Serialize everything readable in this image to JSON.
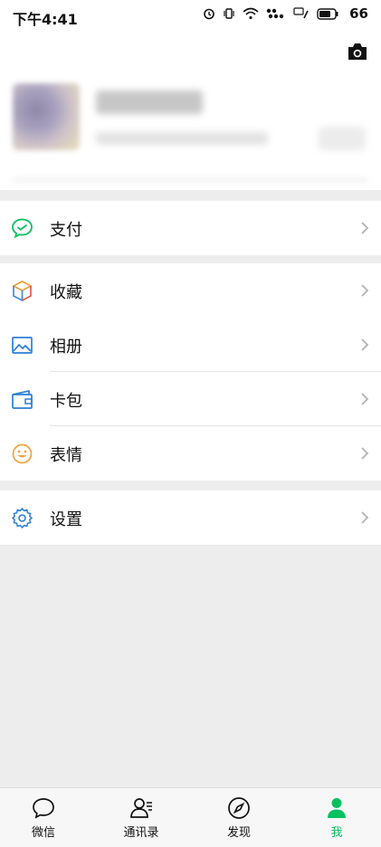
{
  "status_bar": {
    "time": "下午4:41",
    "battery": "66"
  },
  "menu": {
    "pay": "支付",
    "favorites": "收藏",
    "album": "相册",
    "cards": "卡包",
    "stickers": "表情",
    "settings": "设置"
  },
  "tabbar": {
    "chats": "微信",
    "contacts": "通讯录",
    "discover": "发现",
    "me": "我"
  },
  "colors": {
    "accent": "#07c160",
    "background": "#ededed"
  }
}
